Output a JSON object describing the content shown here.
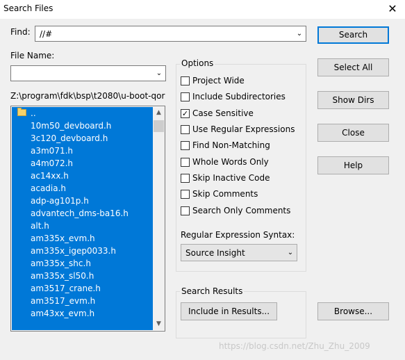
{
  "window": {
    "title": "Search Files",
    "close_glyph": "✕"
  },
  "find": {
    "label": "Find:",
    "value": "//#"
  },
  "file_name": {
    "label": "File Name:",
    "value": ""
  },
  "path": "Z:\\program\\fdk\\bsp\\t2080\\u-boot-qor",
  "file_list": {
    "parent": "..",
    "items": [
      "10m50_devboard.h",
      "3c120_devboard.h",
      "a3m071.h",
      "a4m072.h",
      "ac14xx.h",
      "acadia.h",
      "adp-ag101p.h",
      "advantech_dms-ba16.h",
      "alt.h",
      "am335x_evm.h",
      "am335x_igep0033.h",
      "am335x_shc.h",
      "am335x_sl50.h",
      "am3517_crane.h",
      "am3517_evm.h",
      "am43xx_evm.h"
    ]
  },
  "options": {
    "title": "Options",
    "checkboxes": [
      {
        "label": "Project Wide",
        "checked": false
      },
      {
        "label": "Include Subdirectories",
        "checked": false
      },
      {
        "label": "Case Sensitive",
        "checked": true
      },
      {
        "label": "Use Regular Expressions",
        "checked": false
      },
      {
        "label": "Find Non-Matching",
        "checked": false
      },
      {
        "label": "Whole Words Only",
        "checked": false
      },
      {
        "label": "Skip Inactive Code",
        "checked": false
      },
      {
        "label": "Skip Comments",
        "checked": false
      },
      {
        "label": "Search Only Comments",
        "checked": false
      }
    ],
    "regex_syntax_label": "Regular Expression Syntax:",
    "regex_syntax_value": "Source Insight"
  },
  "search_results": {
    "title": "Search Results",
    "include_button": "Include in Results..."
  },
  "buttons": {
    "search": "Search",
    "select_all": "Select All",
    "show_dirs": "Show Dirs",
    "close": "Close",
    "help": "Help",
    "browse": "Browse..."
  },
  "watermark": "https://blog.csdn.net/Zhu_Zhu_2009",
  "colors": {
    "selection": "#0078d7",
    "default_button_border": "#0078d7"
  }
}
